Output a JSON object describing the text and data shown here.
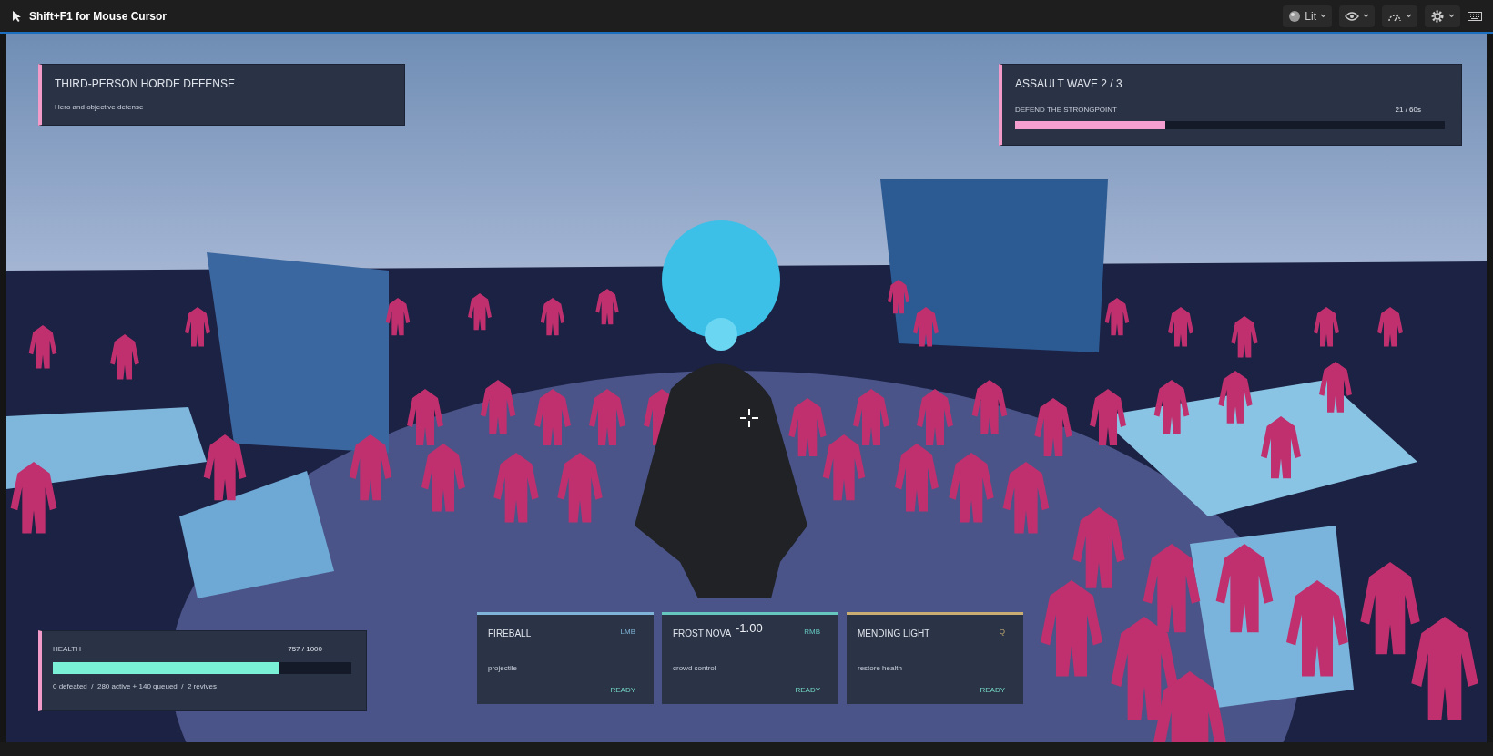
{
  "toolbar": {
    "hint": "Shift+F1 for Mouse Cursor",
    "view_mode": "Lit"
  },
  "title_panel": {
    "title": "THIRD-PERSON HORDE DEFENSE",
    "subtitle": "Hero and objective defense"
  },
  "wave_panel": {
    "title": "ASSAULT WAVE 2 / 3",
    "objective": "DEFEND THE STRONGPOINT",
    "timer": "21 / 60s",
    "level": 0.35
  },
  "health_panel": {
    "label": "HEALTH",
    "value": "757 / 1000",
    "level": 0.757,
    "stats": "0 defeated  /  280 active + 140 queued  /  2 revives"
  },
  "abilities": [
    {
      "name": "FIREBALL",
      "key": "LMB",
      "category": "projectile",
      "status": "READY",
      "color": "#7fb4d8"
    },
    {
      "name": "FROST NOVA",
      "key": "RMB",
      "category": "crowd control",
      "status": "READY",
      "color": "#66c6c0"
    },
    {
      "name": "MENDING LIGHT",
      "key": "Q",
      "category": "restore health",
      "status": "READY",
      "color": "#c9ad72"
    }
  ],
  "damage_number": "-1.00"
}
